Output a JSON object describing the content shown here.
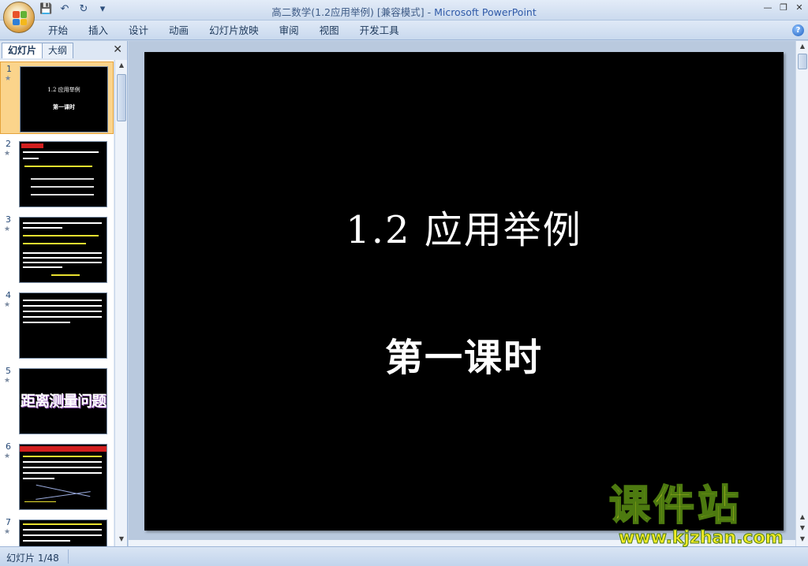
{
  "window": {
    "title": "高二数学(1.2应用举例) [兼容模式] - ",
    "app_name": "Microsoft PowerPoint"
  },
  "quick_access": {
    "save_icon": "save-icon",
    "undo_icon": "undo-icon",
    "redo_icon": "redo-icon",
    "customize_icon": "dropdown-icon"
  },
  "ribbon": {
    "tabs": [
      "开始",
      "插入",
      "设计",
      "动画",
      "幻灯片放映",
      "审阅",
      "视图",
      "开发工具"
    ],
    "help_label": "?"
  },
  "left_pane": {
    "tabs": [
      "幻灯片",
      "大纲"
    ],
    "close_label": "✕",
    "slides": [
      {
        "num": "1",
        "thumb_title": "1.2  应用举例",
        "thumb_sub": "第一课时"
      },
      {
        "num": "2"
      },
      {
        "num": "3"
      },
      {
        "num": "4"
      },
      {
        "num": "5",
        "thumb_title": "距离测量问题"
      },
      {
        "num": "6"
      },
      {
        "num": "7"
      }
    ]
  },
  "slide": {
    "title": "1.2   应用举例",
    "subtitle": "第一课时"
  },
  "watermark": {
    "top": "课件站",
    "bottom": "www.kjzhan.com"
  },
  "status": {
    "slide_counter": "幻灯片 1/48"
  },
  "colors": {
    "accent": "#2f5aa8",
    "selection": "#fbd48b",
    "slide_bg": "#000000"
  }
}
